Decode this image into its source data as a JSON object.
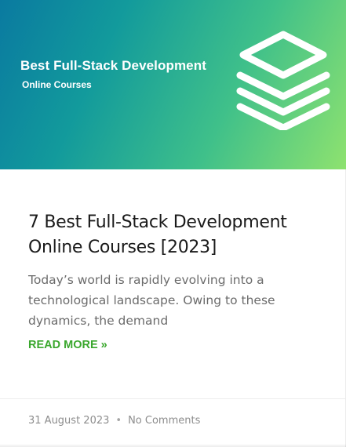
{
  "banner": {
    "title": "Best Full-Stack Development",
    "subtitle": "Online Courses",
    "icon": "stack-layers-icon"
  },
  "post": {
    "title": "7 Best Full-Stack Development Online Courses [2023]",
    "excerpt": "Today’s world is rapidly evolving into a technological landscape. Owing to these dynamics, the demand",
    "read_more": "READ MORE »"
  },
  "meta": {
    "date": "31 August 2023",
    "separator": "•",
    "comments": "No Comments"
  },
  "colors": {
    "accent": "#3aa72d",
    "banner_start": "#0a7aa0",
    "banner_end": "#8ee26f"
  }
}
